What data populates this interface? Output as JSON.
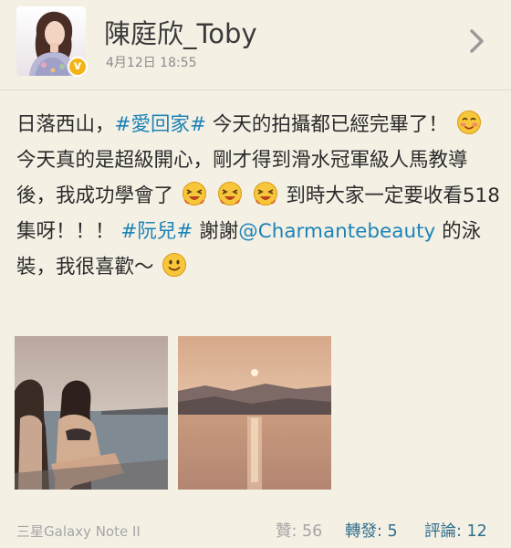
{
  "header": {
    "username": "陳庭欣_Toby",
    "timestamp": "4月12日 18:55",
    "verified_mark": "v",
    "avatar_icon": "profile-photo",
    "chevron_icon": "chevron-right-icon"
  },
  "post": {
    "seg1": "日落西山，",
    "hashtag1": "#愛回家#",
    "seg2": " 今天的拍攝都已經完畢了！",
    "seg3": " 今天真的是超級開心，剛才得到滑水冠軍級人馬教導後，我成功學會了",
    "seg4": " 到時大家一定要收看518集呀！！！",
    "hashtag2": "#阮兒#",
    "seg5": " 謝謝",
    "mention": "@Charmantebeauty",
    "seg6": " 的泳裝，我很喜歡～"
  },
  "photos": [
    {
      "name": "two-women-on-boat-photo"
    },
    {
      "name": "sunset-over-water-photo"
    }
  ],
  "footer": {
    "source": "三星Galaxy Note II",
    "likes_label": "贊",
    "likes_value": ": 56",
    "reposts_label": "轉發",
    "reposts_value": ": 5",
    "comments_label": "評論",
    "comments_value": ": 12"
  },
  "colors": {
    "background": "#f5f0e4",
    "link": "#1d84b8",
    "count_accent": "#2f6f8e",
    "verified": "#f5b416"
  }
}
